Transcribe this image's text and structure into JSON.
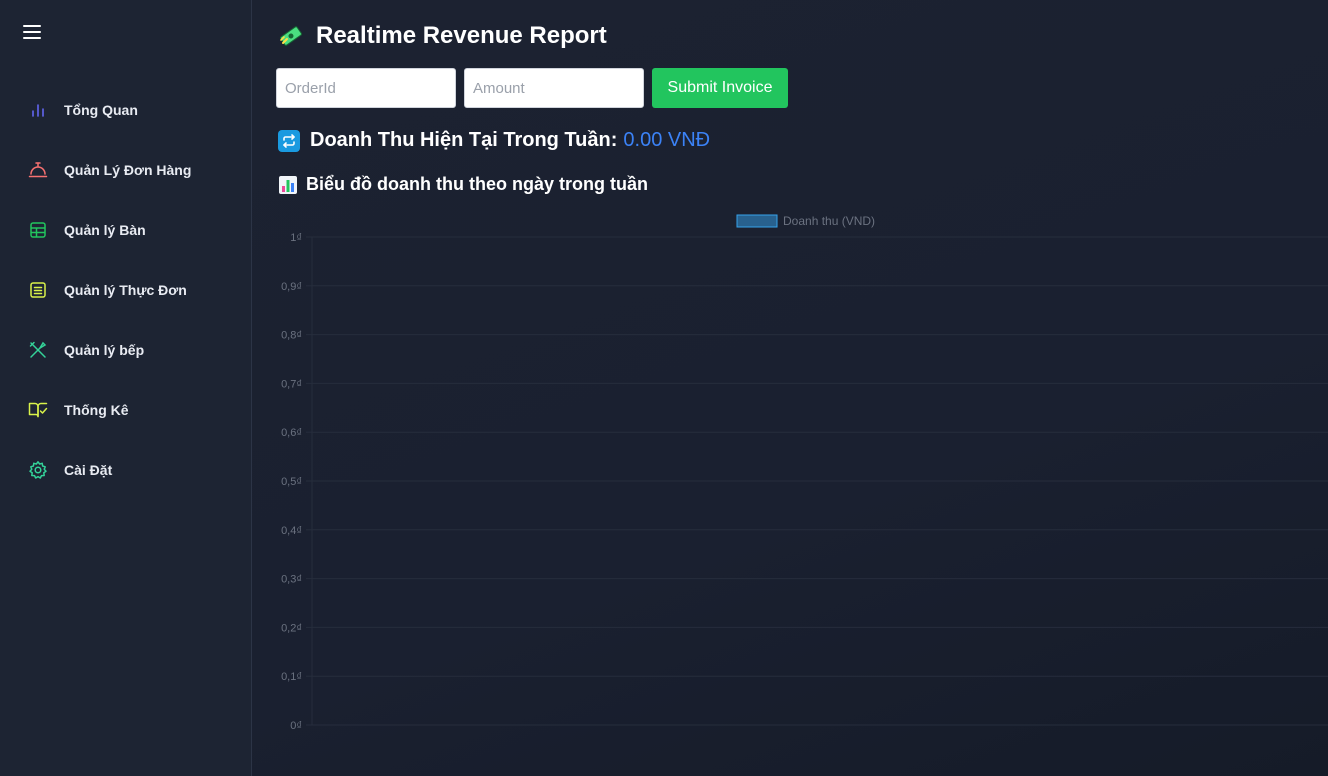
{
  "sidebar": {
    "menu_icon": "hamburger-icon",
    "items": [
      {
        "label": "Tổng Quan",
        "icon": "bar-chart-icon",
        "color": "#6366f1"
      },
      {
        "label": "Quản Lý Đơn Hàng",
        "icon": "service-bell-icon",
        "color": "#f87171"
      },
      {
        "label": "Quản lý Bàn",
        "icon": "table-grid-icon",
        "color": "#22c55e"
      },
      {
        "label": "Quản lý Thực Đơn",
        "icon": "menu-list-icon",
        "color": "#d9f24a"
      },
      {
        "label": "Quản lý bếp",
        "icon": "utensils-crossed-icon",
        "color": "#34d399"
      },
      {
        "label": "Thống Kê",
        "icon": "book-check-icon",
        "color": "#d9f24a"
      },
      {
        "label": "Cài Đặt",
        "icon": "gear-icon",
        "color": "#34d399"
      }
    ]
  },
  "header": {
    "title": "Realtime Revenue Report",
    "icon": "money-icon"
  },
  "form": {
    "order_placeholder": "OrderId",
    "order_value": "",
    "amount_placeholder": "Amount",
    "amount_value": "",
    "submit_label": "Submit Invoice",
    "submit_color": "#22c55e"
  },
  "revenue": {
    "icon": "repeat-icon",
    "label": "Doanh Thu Hiện Tại Trong Tuần:",
    "value": "0.00 VNĐ",
    "value_color": "#3b82f6"
  },
  "chart_section": {
    "icon": "chart-icon",
    "title": "Biểu đồ doanh thu theo ngày trong tuần"
  },
  "chart_data": {
    "type": "bar",
    "categories": [],
    "series": [
      {
        "name": "Doanh thu (VND)",
        "values": [],
        "color": "#36a2eb"
      }
    ],
    "ylim": [
      0,
      1
    ],
    "yticks": [
      "1₫",
      "0,9₫",
      "0,8₫",
      "0,7₫",
      "0,6₫",
      "0,5₫",
      "0,4₫",
      "0,3₫",
      "0,2₫",
      "0,1₫",
      "0₫"
    ],
    "legend_position": "top",
    "grid": true
  }
}
